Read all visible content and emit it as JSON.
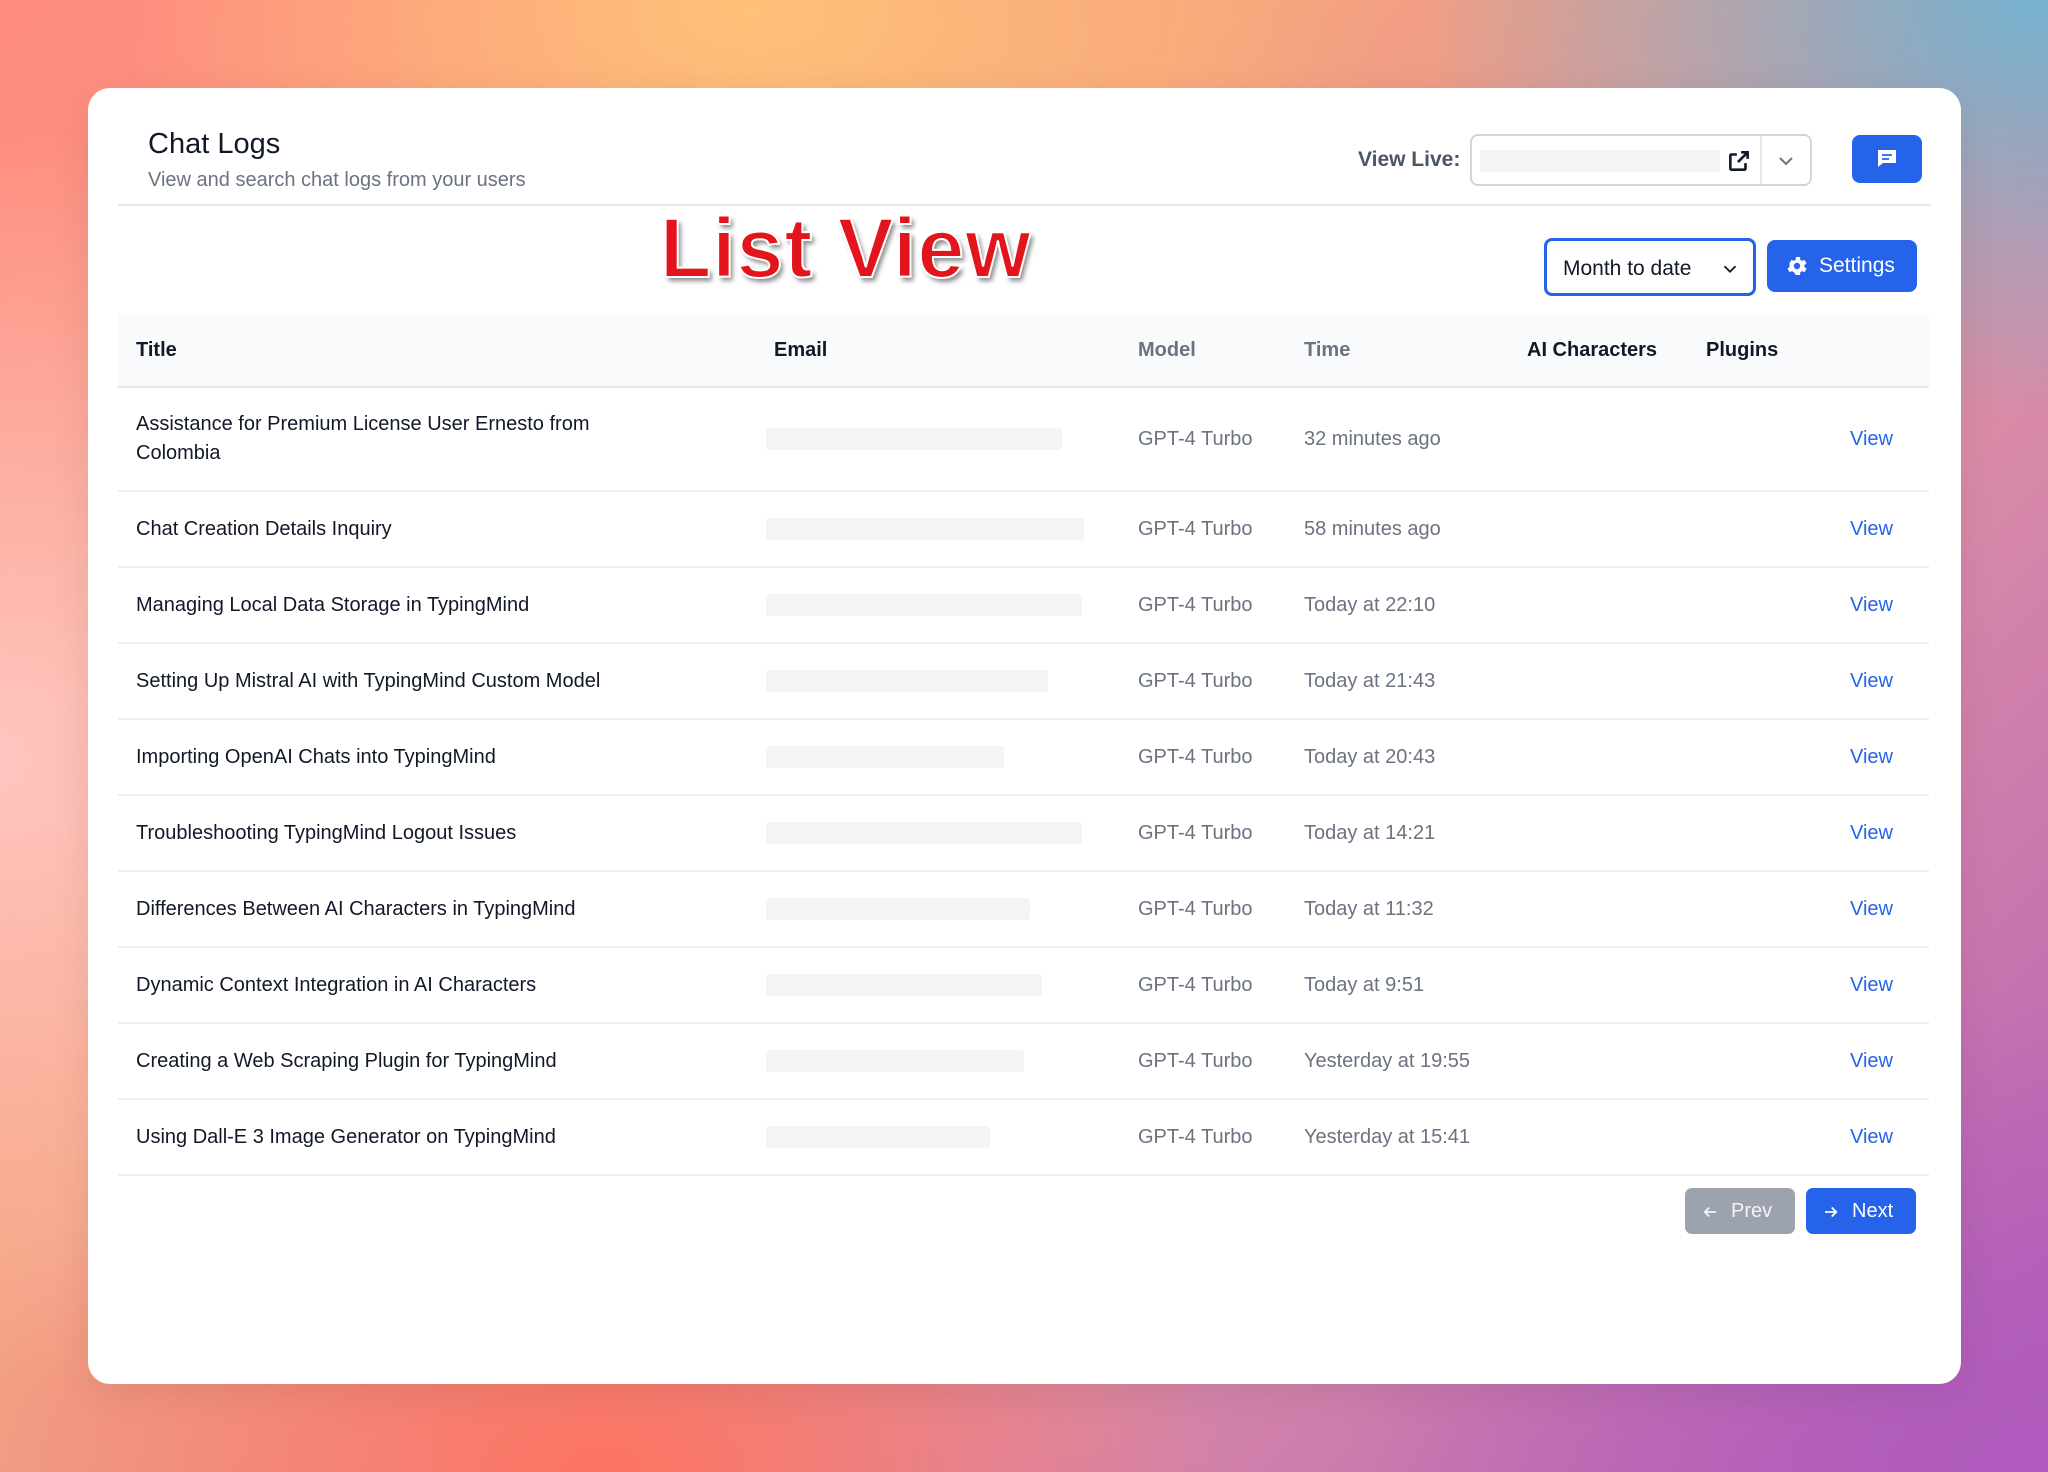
{
  "header": {
    "title": "Chat Logs",
    "subtitle": "View and search chat logs from your users",
    "view_live_label": "View Live:"
  },
  "overlay_label": "List View",
  "toolbar": {
    "period_selected": "Month to date",
    "settings_label": "Settings"
  },
  "table": {
    "columns": [
      "Title",
      "Email",
      "Model",
      "Time",
      "AI Characters",
      "Plugins"
    ],
    "rows": [
      {
        "title": "Assistance for Premium License User Ernesto from Colombia",
        "model": "GPT-4 Turbo",
        "time": "32 minutes ago",
        "action": "View"
      },
      {
        "title": "Chat Creation Details Inquiry",
        "model": "GPT-4 Turbo",
        "time": "58 minutes ago",
        "action": "View"
      },
      {
        "title": "Managing Local Data Storage in TypingMind",
        "model": "GPT-4 Turbo",
        "time": "Today at 22:10",
        "action": "View"
      },
      {
        "title": "Setting Up Mistral AI with TypingMind Custom Model",
        "model": "GPT-4 Turbo",
        "time": "Today at 21:43",
        "action": "View"
      },
      {
        "title": "Importing OpenAI Chats into TypingMind",
        "model": "GPT-4 Turbo",
        "time": "Today at 20:43",
        "action": "View"
      },
      {
        "title": "Troubleshooting TypingMind Logout Issues",
        "model": "GPT-4 Turbo",
        "time": "Today at 14:21",
        "action": "View"
      },
      {
        "title": "Differences Between AI Characters in TypingMind",
        "model": "GPT-4 Turbo",
        "time": "Today at 11:32",
        "action": "View"
      },
      {
        "title": "Dynamic Context Integration in AI Characters",
        "model": "GPT-4 Turbo",
        "time": "Today at 9:51",
        "action": "View"
      },
      {
        "title": "Creating a Web Scraping Plugin for TypingMind",
        "model": "GPT-4 Turbo",
        "time": "Yesterday at 19:55",
        "action": "View"
      },
      {
        "title": "Using Dall-E 3 Image Generator on TypingMind",
        "model": "GPT-4 Turbo",
        "time": "Yesterday at 15:41",
        "action": "View"
      }
    ]
  },
  "pagination": {
    "prev_label": "Prev",
    "next_label": "Next"
  },
  "icons": {
    "external_link": "external-link-icon",
    "dropdown": "chevron-down-icon",
    "chat": "chat-bubble-icon",
    "settings": "gear-icon",
    "prev": "arrow-left-icon",
    "next": "arrow-right-icon"
  },
  "colors": {
    "accent": "#2563eb",
    "overlay_text": "#e3151c",
    "disabled_button": "#9ca3af"
  }
}
